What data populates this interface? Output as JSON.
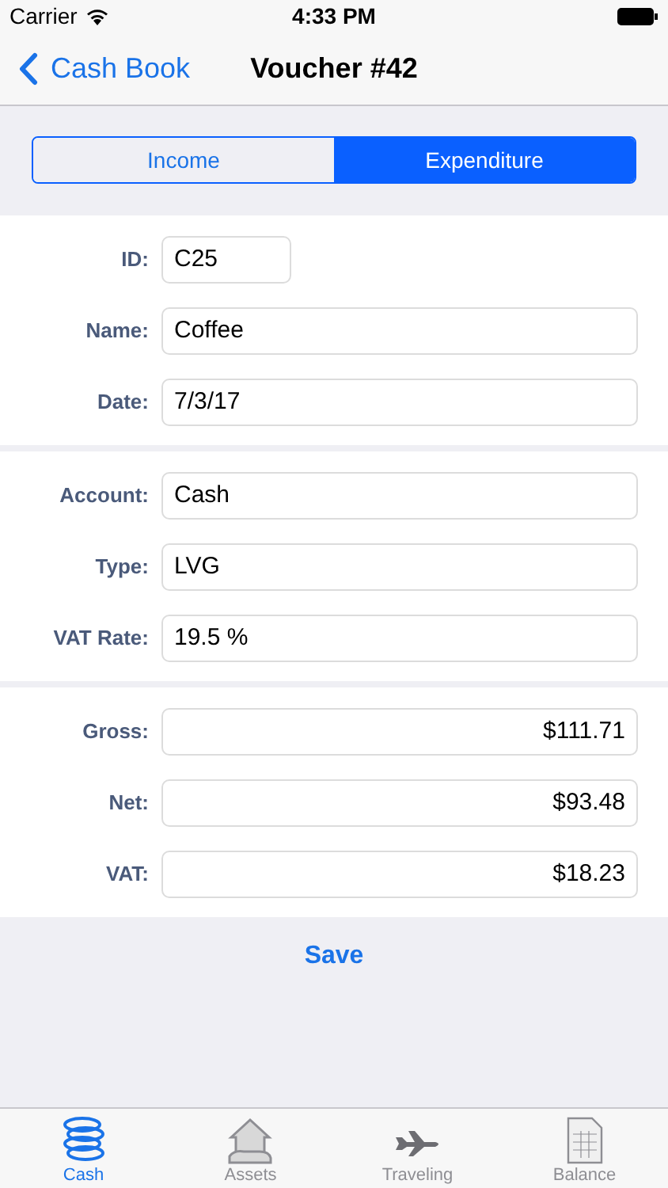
{
  "status_bar": {
    "carrier": "Carrier",
    "time": "4:33 PM"
  },
  "nav": {
    "back": "Cash Book",
    "title": "Voucher #42"
  },
  "segments": [
    {
      "label": "Income",
      "selected": false
    },
    {
      "label": "Expenditure",
      "selected": true
    }
  ],
  "sections": [
    {
      "fields": [
        {
          "label": "ID:",
          "value": "C25",
          "kind": "short"
        },
        {
          "label": "Name:",
          "value": "Coffee",
          "kind": "text"
        },
        {
          "label": "Date:",
          "value": "7/3/17",
          "kind": "text"
        }
      ]
    },
    {
      "fields": [
        {
          "label": "Account:",
          "value": "Cash",
          "kind": "text"
        },
        {
          "label": "Type:",
          "value": "LVG",
          "kind": "text"
        },
        {
          "label": "VAT Rate:",
          "value": "19.5 %",
          "kind": "text"
        }
      ]
    },
    {
      "fields": [
        {
          "label": "Gross:",
          "value": "$111.71",
          "kind": "amount"
        },
        {
          "label": "Net:",
          "value": "$93.48",
          "kind": "amount"
        },
        {
          "label": "VAT:",
          "value": "$18.23",
          "kind": "amount"
        }
      ]
    }
  ],
  "save": "Save",
  "tabs": [
    {
      "label": "Cash",
      "selected": true
    },
    {
      "label": "Assets",
      "selected": false
    },
    {
      "label": "Traveling",
      "selected": false
    },
    {
      "label": "Balance",
      "selected": false
    }
  ]
}
